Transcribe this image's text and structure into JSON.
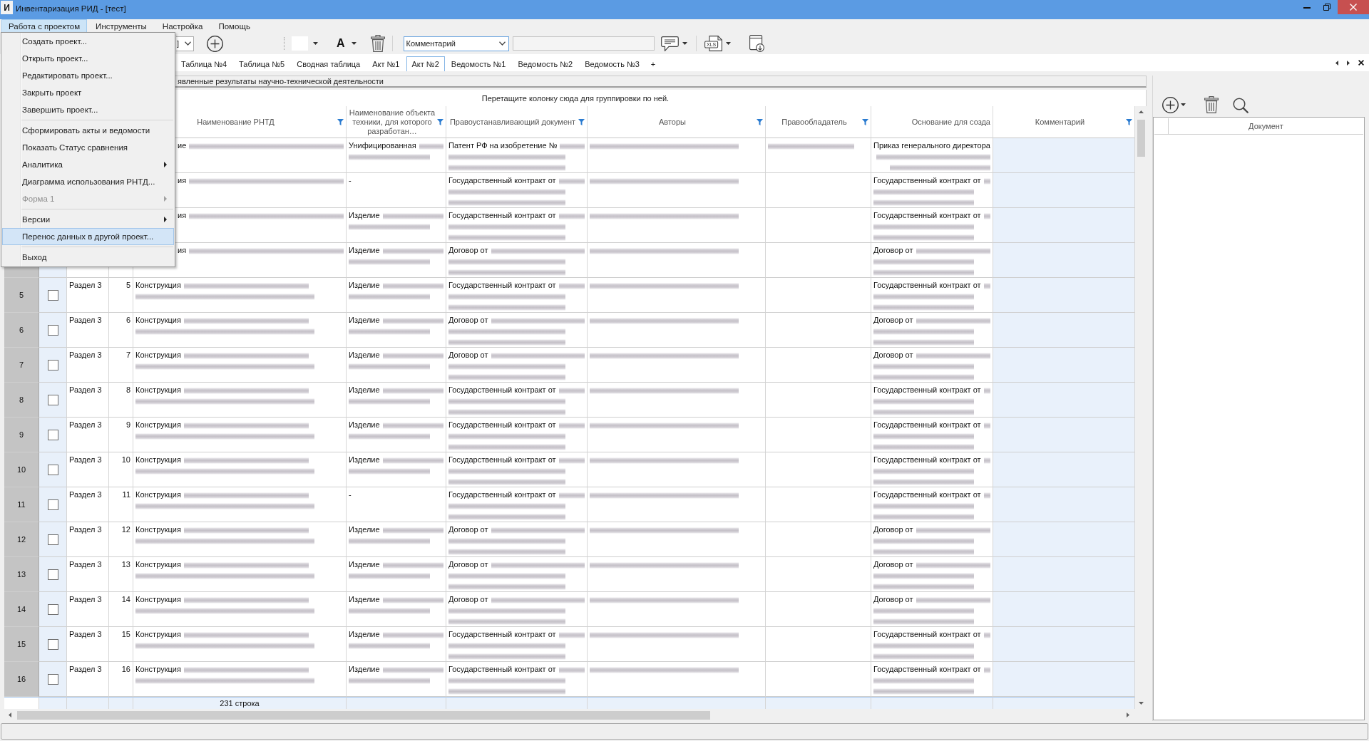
{
  "window": {
    "icon_text": "И",
    "title": "Инвентаризация РИД - [тест]"
  },
  "menu_bar": [
    {
      "label": "Работа с проектом",
      "selected": true
    },
    {
      "label": "Инструменты",
      "selected": false
    },
    {
      "label": "Настройка",
      "selected": false
    },
    {
      "label": "Помощь",
      "selected": false
    }
  ],
  "dropdown": {
    "items": [
      {
        "kind": "item",
        "label": "Создать проект...",
        "submenu": false,
        "disabled": false,
        "selected": false
      },
      {
        "kind": "item",
        "label": "Открыть проект...",
        "submenu": false,
        "disabled": false,
        "selected": false
      },
      {
        "kind": "item",
        "label": "Редактировать проект...",
        "submenu": false,
        "disabled": false,
        "selected": false
      },
      {
        "kind": "item",
        "label": "Закрыть проект",
        "submenu": false,
        "disabled": false,
        "selected": false
      },
      {
        "kind": "item",
        "label": "Завершить проект...",
        "submenu": false,
        "disabled": false,
        "selected": false
      },
      {
        "kind": "separator"
      },
      {
        "kind": "item",
        "label": "Сформировать акты и ведомости",
        "submenu": false,
        "disabled": false,
        "selected": false
      },
      {
        "kind": "item",
        "label": "Показать Статус сравнения",
        "submenu": false,
        "disabled": false,
        "selected": false
      },
      {
        "kind": "item",
        "label": "Аналитика",
        "submenu": true,
        "disabled": false,
        "selected": false
      },
      {
        "kind": "item",
        "label": "Диаграмма использования РНТД...",
        "submenu": false,
        "disabled": false,
        "selected": false
      },
      {
        "kind": "item",
        "label": "Форма 1",
        "submenu": true,
        "disabled": true,
        "selected": false
      },
      {
        "kind": "separator"
      },
      {
        "kind": "item",
        "label": "Версии",
        "submenu": true,
        "disabled": false,
        "selected": false
      },
      {
        "kind": "item",
        "label": "Перенос данных в другой проект...",
        "submenu": false,
        "disabled": false,
        "selected": true
      },
      {
        "kind": "separator"
      },
      {
        "kind": "item",
        "label": "Выход",
        "submenu": false,
        "disabled": false,
        "selected": false
      }
    ]
  },
  "toolbar": {
    "view_combo": "]",
    "font_color_label": "A",
    "field_combo": "Комментарий",
    "value_field": {
      "disabled": true
    },
    "export_icon_text": "XLS"
  },
  "tabs": [
    {
      "label": "Таблица №4",
      "selected": false
    },
    {
      "label": "Таблица №5",
      "selected": false
    },
    {
      "label": "Сводная таблица",
      "selected": false
    },
    {
      "label": "Акт №1",
      "selected": false
    },
    {
      "label": "Акт №2",
      "selected": true
    },
    {
      "label": "Ведомость №1",
      "selected": false
    },
    {
      "label": "Ведомость №2",
      "selected": false
    },
    {
      "label": "Ведомость №3",
      "selected": false
    }
  ],
  "tab_add_label": "+",
  "grid": {
    "caption": "явленные результаты научно-технической деятельности",
    "group_hint": "Перетащите колонку сюда для группировки по ней.",
    "columns": [
      {
        "kind": "text"
      },
      {
        "kind": "number"
      },
      {
        "kind": "text",
        "title": "Наименование РНТД",
        "filter": true
      },
      {
        "kind": "text",
        "title": "Наименование объекта техники, для которого разработан…",
        "filter": true
      },
      {
        "kind": "text",
        "title": "Правоустанавливающий документ",
        "filter": true
      },
      {
        "kind": "text",
        "title": "Авторы",
        "filter": true
      },
      {
        "kind": "text",
        "title": "Правообладатель",
        "filter": true
      },
      {
        "kind": "text",
        "title": "Основание для созда",
        "filter": false
      },
      {
        "kind": "editable",
        "title": "Комментарий",
        "filter": true
      }
    ],
    "rows": [
      {
        "cells": [
          {},
          {},
          {
            "text": "ие",
            "redacted": true
          },
          {
            "text": "Унифицированная",
            "redacted": true
          },
          {
            "text": "Патент РФ на изобретение №",
            "redacted": true
          },
          {
            "redacted": true
          },
          {
            "redacted": true
          },
          {
            "text": "Приказ генерального директора",
            "redacted": true
          },
          {
            "redacted": false
          }
        ]
      },
      {
        "cells": [
          {},
          {},
          {
            "text": "ия",
            "redacted": true
          },
          {
            "text": "-",
            "redacted": false
          },
          {
            "text": "Государственный контракт от",
            "redacted": true
          },
          {
            "redacted": true
          },
          {
            "redacted": false
          },
          {
            "text": "Государственный контракт от",
            "redacted": true
          },
          {
            "redacted": false
          }
        ]
      },
      {
        "cells": [
          {},
          {},
          {
            "text": "ия",
            "redacted": true
          },
          {
            "text": "Изделие",
            "redacted": true
          },
          {
            "text": "Государственный контракт от",
            "redacted": true
          },
          {
            "redacted": true
          },
          {
            "redacted": false
          },
          {
            "text": "Государственный контракт от",
            "redacted": true
          },
          {
            "redacted": false
          }
        ]
      },
      {
        "cells": [
          {},
          {},
          {
            "text": "ия",
            "redacted": true
          },
          {
            "text": "Изделие",
            "redacted": true
          },
          {
            "text": "Договор от",
            "redacted": true
          },
          {
            "redacted": true
          },
          {
            "redacted": false
          },
          {
            "text": "Договор от",
            "redacted": true
          },
          {
            "redacted": false
          }
        ]
      },
      {
        "number": "5",
        "checked": false,
        "cells": [
          {
            "text": "Раздел 3",
            "redacted": false
          },
          {
            "text": "5",
            "redacted": false
          },
          {
            "text": "Конструкция",
            "redacted": true
          },
          {
            "text": "Изделие",
            "redacted": true
          },
          {
            "text": "Государственный контракт от",
            "redacted": true
          },
          {
            "redacted": true
          },
          {
            "redacted": false
          },
          {
            "text": "Государственный контракт от",
            "redacted": true
          },
          {
            "redacted": false
          }
        ]
      },
      {
        "number": "6",
        "checked": false,
        "cells": [
          {
            "text": "Раздел 3",
            "redacted": false
          },
          {
            "text": "6",
            "redacted": false
          },
          {
            "text": "Конструкция",
            "redacted": true
          },
          {
            "text": "Изделие",
            "redacted": true
          },
          {
            "text": "Договор от",
            "redacted": true
          },
          {
            "redacted": true
          },
          {
            "redacted": false
          },
          {
            "text": "Договор от",
            "redacted": true
          },
          {
            "redacted": false
          }
        ]
      },
      {
        "number": "7",
        "checked": false,
        "cells": [
          {
            "text": "Раздел 3",
            "redacted": false
          },
          {
            "text": "7",
            "redacted": false
          },
          {
            "text": "Конструкция",
            "redacted": true
          },
          {
            "text": "Изделие",
            "redacted": true
          },
          {
            "text": "Договор от",
            "redacted": true
          },
          {
            "redacted": true
          },
          {
            "redacted": false
          },
          {
            "text": "Договор от",
            "redacted": true
          },
          {
            "redacted": false
          }
        ]
      },
      {
        "number": "8",
        "checked": false,
        "cells": [
          {
            "text": "Раздел 3",
            "redacted": false
          },
          {
            "text": "8",
            "redacted": false
          },
          {
            "text": "Конструкция",
            "redacted": true
          },
          {
            "text": "Изделие",
            "redacted": true
          },
          {
            "text": "Государственный контракт от",
            "redacted": true
          },
          {
            "redacted": true
          },
          {
            "redacted": false
          },
          {
            "text": "Государственный контракт от",
            "redacted": true
          },
          {
            "redacted": false
          }
        ]
      },
      {
        "number": "9",
        "checked": false,
        "cells": [
          {
            "text": "Раздел 3",
            "redacted": false
          },
          {
            "text": "9",
            "redacted": false
          },
          {
            "text": "Конструкция",
            "redacted": true
          },
          {
            "text": "Изделие",
            "redacted": true
          },
          {
            "text": "Государственный контракт от",
            "redacted": true
          },
          {
            "redacted": true
          },
          {
            "redacted": false
          },
          {
            "text": "Государственный контракт от",
            "redacted": true
          },
          {
            "redacted": false
          }
        ]
      },
      {
        "number": "10",
        "checked": false,
        "cells": [
          {
            "text": "Раздел 3",
            "redacted": false
          },
          {
            "text": "10",
            "redacted": false
          },
          {
            "text": "Конструкция",
            "redacted": true
          },
          {
            "text": "Изделие",
            "redacted": true
          },
          {
            "text": "Государственный контракт от",
            "redacted": true
          },
          {
            "redacted": true
          },
          {
            "redacted": false
          },
          {
            "text": "Государственный контракт от",
            "redacted": true
          },
          {
            "redacted": false
          }
        ]
      },
      {
        "number": "11",
        "checked": false,
        "cells": [
          {
            "text": "Раздел 3",
            "redacted": false
          },
          {
            "text": "11",
            "redacted": false
          },
          {
            "text": "Конструкция",
            "redacted": true
          },
          {
            "text": "-",
            "redacted": false
          },
          {
            "text": "Государственный контракт от",
            "redacted": true
          },
          {
            "redacted": true
          },
          {
            "redacted": false
          },
          {
            "text": "Государственный контракт от",
            "redacted": true
          },
          {
            "redacted": false
          }
        ]
      },
      {
        "number": "12",
        "checked": false,
        "cells": [
          {
            "text": "Раздел 3",
            "redacted": false
          },
          {
            "text": "12",
            "redacted": false
          },
          {
            "text": "Конструкция",
            "redacted": true
          },
          {
            "text": "Изделие",
            "redacted": true
          },
          {
            "text": "Договор от",
            "redacted": true
          },
          {
            "redacted": true
          },
          {
            "redacted": false
          },
          {
            "text": "Договор от",
            "redacted": true
          },
          {
            "redacted": false
          }
        ]
      },
      {
        "number": "13",
        "checked": false,
        "cells": [
          {
            "text": "Раздел 3",
            "redacted": false
          },
          {
            "text": "13",
            "redacted": false
          },
          {
            "text": "Конструкция",
            "redacted": true
          },
          {
            "text": "Изделие",
            "redacted": true
          },
          {
            "text": "Договор от",
            "redacted": true
          },
          {
            "redacted": true
          },
          {
            "redacted": false
          },
          {
            "text": "Договор от",
            "redacted": true
          },
          {
            "redacted": false
          }
        ]
      },
      {
        "number": "14",
        "checked": false,
        "cells": [
          {
            "text": "Раздел 3",
            "redacted": false
          },
          {
            "text": "14",
            "redacted": false
          },
          {
            "text": "Конструкция",
            "redacted": true
          },
          {
            "text": "Изделие",
            "redacted": true
          },
          {
            "text": "Договор от",
            "redacted": true
          },
          {
            "redacted": true
          },
          {
            "redacted": false
          },
          {
            "text": "Договор от",
            "redacted": true
          },
          {
            "redacted": false
          }
        ]
      },
      {
        "number": "15",
        "checked": false,
        "cells": [
          {
            "text": "Раздел 3",
            "redacted": false
          },
          {
            "text": "15",
            "redacted": false
          },
          {
            "text": "Конструкция",
            "redacted": true
          },
          {
            "text": "Изделие",
            "redacted": true
          },
          {
            "text": "Государственный контракт от",
            "redacted": true
          },
          {
            "redacted": true
          },
          {
            "redacted": false
          },
          {
            "text": "Государственный контракт от",
            "redacted": true
          },
          {
            "redacted": false
          }
        ]
      },
      {
        "number": "16",
        "checked": false,
        "cells": [
          {
            "text": "Раздел 3",
            "redacted": false
          },
          {
            "text": "16",
            "redacted": false
          },
          {
            "text": "Конструкция",
            "redacted": true
          },
          {
            "text": "Изделие",
            "redacted": true
          },
          {
            "text": "Государственный контракт от",
            "redacted": true
          },
          {
            "redacted": true
          },
          {
            "redacted": false
          },
          {
            "text": "Государственный контракт от",
            "redacted": true
          },
          {
            "redacted": false
          }
        ]
      }
    ],
    "footer": "231 строка"
  },
  "side_panel": {
    "columns": [
      {
        "kind": "indicator"
      },
      {
        "kind": "text",
        "title": "Документ"
      }
    ]
  }
}
